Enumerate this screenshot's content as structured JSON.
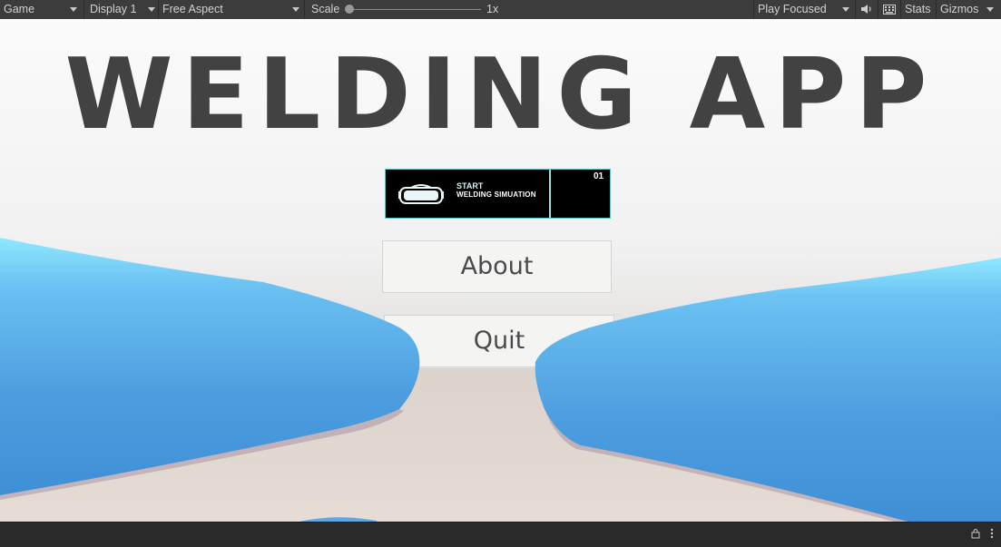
{
  "toolbar": {
    "view_label": "Game",
    "display_label": "Display 1",
    "aspect_label": "Free Aspect",
    "scale_label": "Scale",
    "scale_value": "1x",
    "scale_level": 0,
    "play_mode_label": "Play Focused",
    "stats_label": "Stats",
    "gizmos_label": "Gizmos",
    "mute_icon": "speaker-icon",
    "keyboard_icon": "keyboard-icon"
  },
  "game": {
    "title": "WELDING APP",
    "start_button": {
      "line1": "START",
      "line2": "WELDING SIMUATION",
      "number": "01",
      "icon": "vr-headset-icon",
      "text_color": "#d6f2f2",
      "accent_color": "#5cc6c6"
    },
    "about_label": "About",
    "quit_label": "Quit",
    "hand_color": "#5aa8e6"
  },
  "bottom": {
    "lock_icon": "lock-icon",
    "more_icon": "kebab-menu-icon"
  }
}
